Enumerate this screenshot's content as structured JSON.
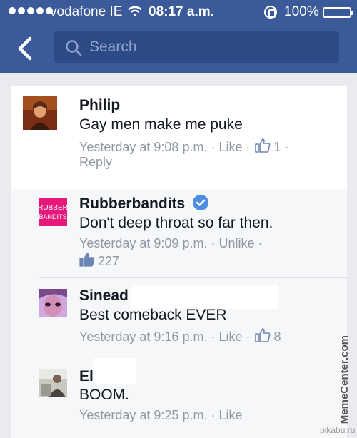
{
  "status_bar": {
    "carrier": "vodafone IE",
    "time": "08:17 a.m.",
    "battery": "100%",
    "battery_level": 1.0
  },
  "nav": {
    "search_placeholder": "Search"
  },
  "comments": [
    {
      "name": "Philip",
      "text": "Gay men make me puke",
      "time": "Yesterday at 9:08 p.m.",
      "action": "Like",
      "likes": "1",
      "reply": "Reply"
    },
    {
      "name": "Rubberbandits",
      "verified": true,
      "avatar_text": "RUBBER BANDITS",
      "text": "Don't deep throat so far then.",
      "time": "Yesterday at 9:09 p.m.",
      "action": "Unlike",
      "likes": "227"
    },
    {
      "name": "Sinead",
      "text": "Best comeback EVER",
      "time": "Yesterday at 9:16 p.m.",
      "action": "Like",
      "likes": "8"
    },
    {
      "name": "El",
      "text": "BOOM.",
      "time": "Yesterday at 9:25 p.m.",
      "action": "Like"
    }
  ],
  "watermark": "MemeCenter.com",
  "source": "pikabu.ru",
  "colors": {
    "facebook_blue": "#3b5a9a",
    "search_field": "#2b4a86",
    "meta_grey": "#9197a3",
    "verified_blue": "#4e8ee0",
    "rubberbandits_pink": "#e6197a"
  }
}
